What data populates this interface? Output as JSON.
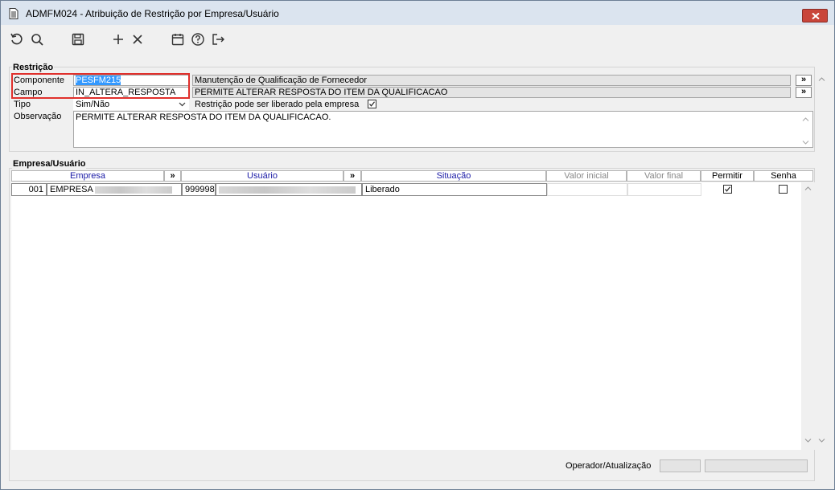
{
  "window": {
    "title": "ADMFM024 - Atribuição de Restrição por Empresa/Usuário"
  },
  "toolbar": {
    "icons": [
      "refresh-icon",
      "search-icon",
      "save-icon",
      "add-icon",
      "delete-icon",
      "calendar-icon",
      "help-icon",
      "exit-icon"
    ]
  },
  "restricao": {
    "group_label": "Restrição",
    "componente_label": "Componente",
    "componente_value": "PESFM215",
    "componente_desc": "Manutenção de Qualificação de Fornecedor",
    "campo_label": "Campo",
    "campo_value": "IN_ALTERA_RESPOSTA",
    "campo_desc": "PERMITE ALTERAR RESPOSTA DO ITEM DA QUALIFICACAO",
    "tipo_label": "Tipo",
    "tipo_value": "Sim/Não",
    "liberado_label": "Restrição pode ser liberado pela empresa",
    "liberado_checked": true,
    "observacao_label": "Observação",
    "observacao_value": "PERMITE ALTERAR RESPOSTA DO ITEM DA QUALIFICACAO.",
    "more_button": "»"
  },
  "empresa_usuario": {
    "group_label": "Empresa/Usuário",
    "columns": {
      "empresa": "Empresa",
      "usuario": "Usuário",
      "situacao": "Situação",
      "valor_inicial": "Valor inicial",
      "valor_final": "Valor final",
      "permitir": "Permitir",
      "senha": "Senha"
    },
    "more_button": "»",
    "rows": [
      {
        "empresa_code": "001",
        "empresa_name": "EMPRESA",
        "usuario_code": "999998",
        "situacao": "Liberado",
        "valor_inicial": "",
        "valor_final": "",
        "permitir": true,
        "senha": false
      }
    ]
  },
  "footer": {
    "operador_label": "Operador/Atualização"
  },
  "colors": {
    "titlebar": "#dbe4ef",
    "close": "#c9453a",
    "header_link": "#1a1aa6",
    "highlight": "#e0302c",
    "selection": "#3399ff"
  }
}
